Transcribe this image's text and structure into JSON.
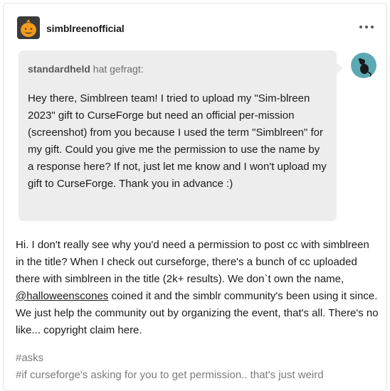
{
  "post": {
    "blog_name": "simblreenofficial",
    "avatar_icon": "pumpkin-icon",
    "more_icon": "more-options-icon"
  },
  "ask": {
    "asker": "standardheld",
    "verb": "hat gefragt:",
    "asker_avatar_icon": "rat-avatar-icon",
    "text": "Hey there, Simblreen team! I tried to upload my \"Sim-blreen 2023\" gift to CurseForge but need an official per-mission (screenshot) from you because I used the term \"Simblreen\" for my gift. Could you give me the permission to use the name by a response here? If not, just let me know and I won't upload my gift to CurseForge. Thank you in advance :)"
  },
  "answer": {
    "before_mention": "Hi. I don't really see why you'd need a permission to post cc with simblreen in the title? When I check out curseforge, there's a bunch of cc uploaded there with simblreen in the title (2k+ results). We don`t own the name, ",
    "mention": "@halloweenscones",
    "after_mention": " coined it and the simblr community's been using it since. We just help the community out by organizing the event, that's all. There's no like... copyright claim here."
  },
  "tags": [
    "#asks",
    "#if curseforge's asking for you to get permission.. that's just weird"
  ],
  "colors": {
    "ask_background": "#ededed",
    "avatar_background": "#3b3b3b",
    "pumpkin": "#f39a1c",
    "asker_avatar_background": "#5aa9b3"
  }
}
